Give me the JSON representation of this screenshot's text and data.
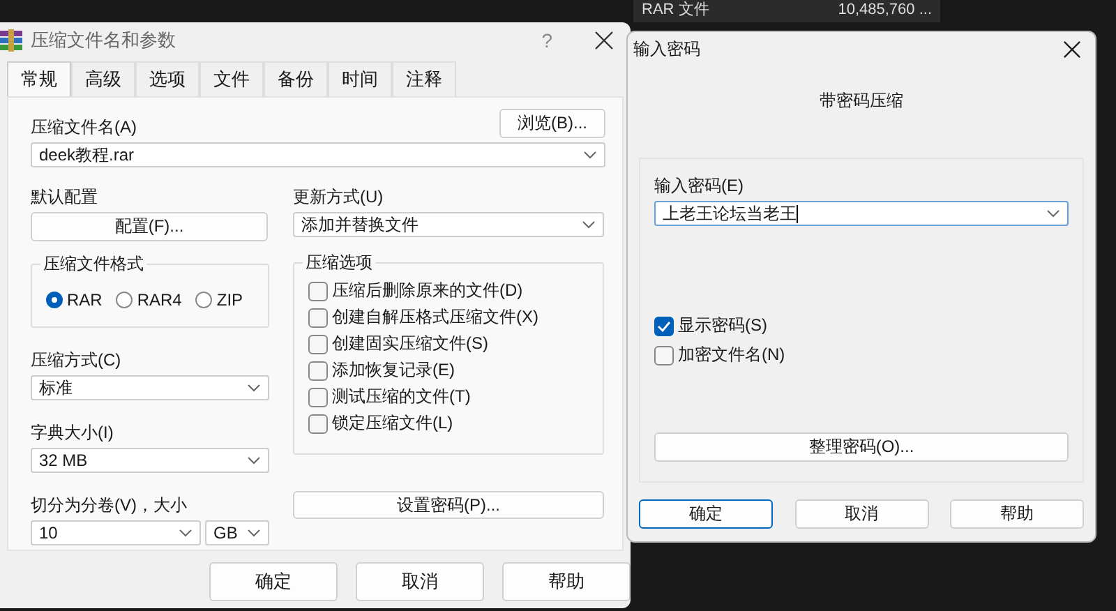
{
  "background": {
    "file_type": "RAR 文件",
    "file_size": "10,485,760 ..."
  },
  "main_dialog": {
    "title": "压缩文件名和参数",
    "help_glyph": "?",
    "tabs": [
      {
        "label": "常规",
        "selected": true
      },
      {
        "label": "高级",
        "selected": false
      },
      {
        "label": "选项",
        "selected": false
      },
      {
        "label": "文件",
        "selected": false
      },
      {
        "label": "备份",
        "selected": false
      },
      {
        "label": "时间",
        "selected": false
      },
      {
        "label": "注释",
        "selected": false
      }
    ],
    "archive_name": {
      "label": "压缩文件名(A)",
      "value": "deek教程.rar",
      "browse_button": "浏览(B)..."
    },
    "profile": {
      "label": "默认配置",
      "button": "配置(F)..."
    },
    "update_mode": {
      "label": "更新方式(U)",
      "value": "添加并替换文件"
    },
    "format": {
      "title": "压缩文件格式",
      "options": [
        {
          "label": "RAR",
          "selected": true
        },
        {
          "label": "RAR4",
          "selected": false
        },
        {
          "label": "ZIP",
          "selected": false
        }
      ]
    },
    "method": {
      "label": "压缩方式(C)",
      "value": "标准"
    },
    "dictionary": {
      "label": "字典大小(I)",
      "value": "32 MB"
    },
    "split": {
      "label": "切分为分卷(V)，大小",
      "value": "10",
      "unit": "GB"
    },
    "options": {
      "title": "压缩选项",
      "items": [
        {
          "label": "压缩后删除原来的文件(D)",
          "checked": false
        },
        {
          "label": "创建自解压格式压缩文件(X)",
          "checked": false
        },
        {
          "label": "创建固实压缩文件(S)",
          "checked": false
        },
        {
          "label": "添加恢复记录(E)",
          "checked": false
        },
        {
          "label": "测试压缩的文件(T)",
          "checked": false
        },
        {
          "label": "锁定压缩文件(L)",
          "checked": false
        }
      ]
    },
    "password_button": "设置密码(P)...",
    "buttons": [
      {
        "label": "确定",
        "focused": false
      },
      {
        "label": "取消",
        "focused": false
      },
      {
        "label": "帮助",
        "focused": false
      }
    ]
  },
  "password_dialog": {
    "title": "输入密码",
    "subtitle": "带密码压缩",
    "password": {
      "label": "输入密码(E)",
      "value": "上老王论坛当老王"
    },
    "options": [
      {
        "label": "显示密码(S)",
        "checked": true
      },
      {
        "label": "加密文件名(N)",
        "checked": false
      }
    ],
    "organize_button": "整理密码(O)...",
    "buttons": [
      {
        "label": "确定",
        "focused": true
      },
      {
        "label": "取消",
        "focused": false
      },
      {
        "label": "帮助",
        "focused": false
      }
    ]
  }
}
